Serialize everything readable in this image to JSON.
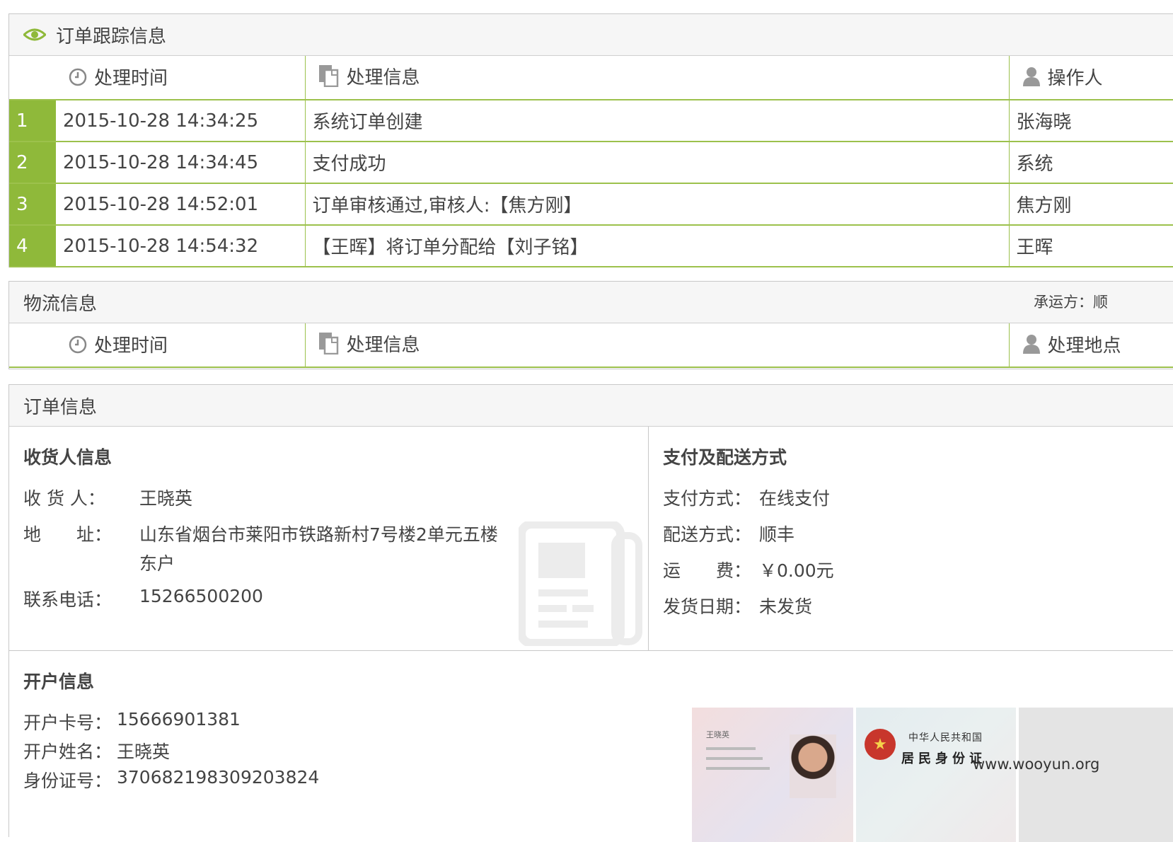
{
  "tracking": {
    "title": "订单跟踪信息",
    "columns": {
      "time": "处理时间",
      "info": "处理信息",
      "operator": "操作人"
    },
    "rows": [
      {
        "index": "1",
        "time": "2015-10-28 14:34:25",
        "info": "系统订单创建",
        "operator": "张海晓"
      },
      {
        "index": "2",
        "time": "2015-10-28 14:34:45",
        "info": "支付成功",
        "operator": "系统"
      },
      {
        "index": "3",
        "time": "2015-10-28 14:52:01",
        "info": "订单审核通过,审核人:【焦方刚】",
        "operator": "焦方刚"
      },
      {
        "index": "4",
        "time": "2015-10-28 14:54:32",
        "info": "【王晖】将订单分配给【刘子铭】",
        "operator": "王晖"
      }
    ]
  },
  "logistics": {
    "title": "物流信息",
    "carrier_text": "承运方：顺",
    "columns": {
      "time": "处理时间",
      "info": "处理信息",
      "place": "处理地点"
    }
  },
  "order": {
    "title": "订单信息",
    "consignee": {
      "title": "收货人信息",
      "name_label": "收 货 人：",
      "name_value": "王晓英",
      "address_label": "地　　址：",
      "address_line1": "山东省烟台市莱阳市铁路新村7号楼2单元五楼",
      "address_line2": "东户",
      "phone_label": "联系电话：",
      "phone_value": "15266500200"
    },
    "payment": {
      "title": "支付及配送方式",
      "pay_label": "支付方式：",
      "pay_value": "在线支付",
      "ship_label": "配送方式：",
      "ship_value": "顺丰",
      "fee_label": "运　　费：",
      "fee_value": "￥0.00元",
      "date_label": "发货日期：",
      "date_value": "未发货"
    },
    "account": {
      "title": "开户信息",
      "card_label": "开户卡号：",
      "card_value": "15666901381",
      "name_label": "开户姓名：",
      "name_value": "王晓英",
      "id_label": "身份证号：",
      "id_value": "370682198309203824"
    },
    "id_photos": {
      "front_name": "王晓英",
      "back_title1": "中华人民共和国",
      "back_title2": "居民身份证"
    }
  },
  "watermark": "www.wooyun.org",
  "colors": {
    "accent_green": "#8fb93a",
    "border_green": "#9cc14c",
    "header_bg": "#f6f6f6"
  }
}
